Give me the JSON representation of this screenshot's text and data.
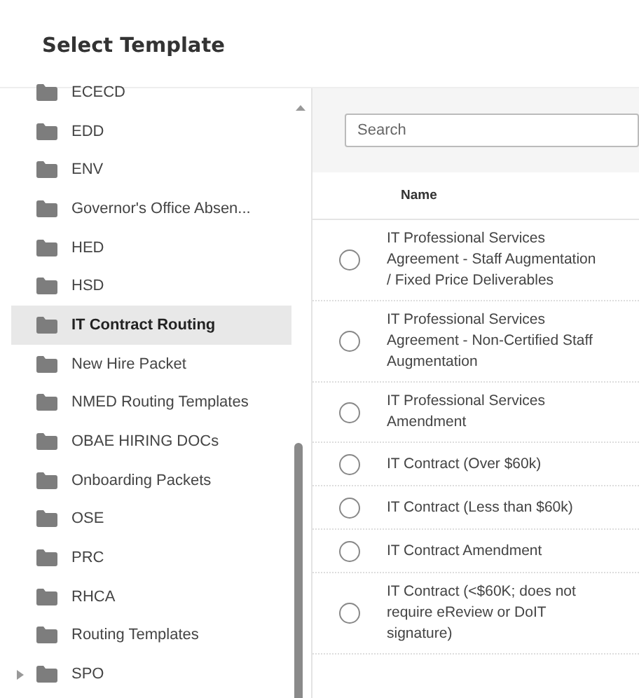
{
  "title": "Select Template",
  "folders": [
    {
      "label": "ECECD",
      "selected": false,
      "expandable": false
    },
    {
      "label": "EDD",
      "selected": false,
      "expandable": false
    },
    {
      "label": "ENV",
      "selected": false,
      "expandable": false
    },
    {
      "label": "Governor's Office Absen...",
      "selected": false,
      "expandable": false
    },
    {
      "label": "HED",
      "selected": false,
      "expandable": false
    },
    {
      "label": "HSD",
      "selected": false,
      "expandable": false
    },
    {
      "label": "IT Contract Routing",
      "selected": true,
      "expandable": false
    },
    {
      "label": "New Hire Packet",
      "selected": false,
      "expandable": false
    },
    {
      "label": "NMED Routing Templates",
      "selected": false,
      "expandable": false
    },
    {
      "label": "OBAE HIRING DOCs",
      "selected": false,
      "expandable": false
    },
    {
      "label": "Onboarding Packets",
      "selected": false,
      "expandable": false
    },
    {
      "label": "OSE",
      "selected": false,
      "expandable": false
    },
    {
      "label": "PRC",
      "selected": false,
      "expandable": false
    },
    {
      "label": "RHCA",
      "selected": false,
      "expandable": false
    },
    {
      "label": "Routing Templates",
      "selected": false,
      "expandable": false
    },
    {
      "label": "SPO",
      "selected": false,
      "expandable": true
    }
  ],
  "search": {
    "placeholder": "Search"
  },
  "table": {
    "columns": [
      "Name"
    ],
    "rows": [
      {
        "name": "IT Professional Services Agreement - Staff Augmentation / Fixed Price Deliverables",
        "selected": false
      },
      {
        "name": "IT Professional Services Agreement - Non-Certified Staff Augmentation",
        "selected": false
      },
      {
        "name": "IT Professional Services Amendment",
        "selected": false
      },
      {
        "name": "IT Contract (Over $60k)",
        "selected": false
      },
      {
        "name": "IT Contract (Less than $60k)",
        "selected": false
      },
      {
        "name": "IT Contract Amendment",
        "selected": false
      },
      {
        "name": "IT Contract (<$60K; does not require eReview or DoIT signature)",
        "selected": false
      }
    ]
  }
}
